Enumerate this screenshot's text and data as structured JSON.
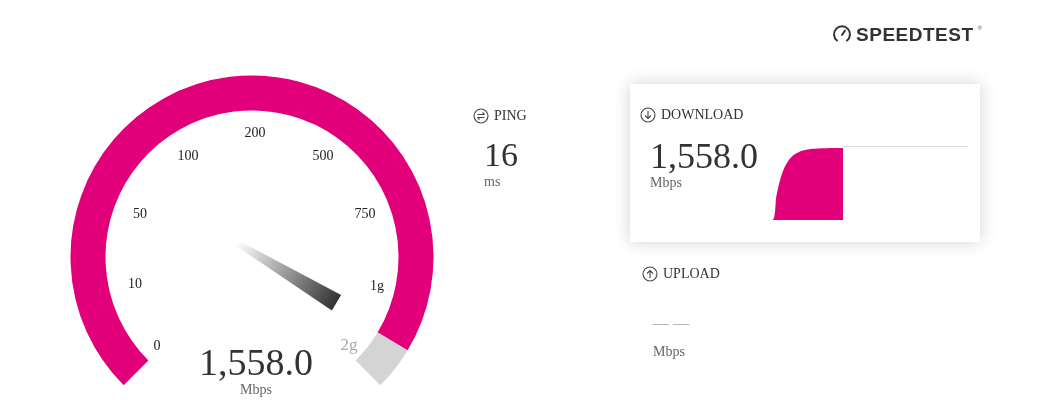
{
  "logo": {
    "text": "SPEEDTEST",
    "registered": "®"
  },
  "gauge": {
    "ticks": [
      {
        "label": "0",
        "dimmed": false
      },
      {
        "label": "10",
        "dimmed": false
      },
      {
        "label": "50",
        "dimmed": false
      },
      {
        "label": "100",
        "dimmed": false
      },
      {
        "label": "200",
        "dimmed": false
      },
      {
        "label": "500",
        "dimmed": false
      },
      {
        "label": "750",
        "dimmed": false
      },
      {
        "label": "1g",
        "dimmed": false
      },
      {
        "label": "2g",
        "dimmed": true
      }
    ],
    "value": "1,558.0",
    "unit": "Mbps"
  },
  "ping": {
    "label": "PING",
    "value": "16",
    "unit": "ms"
  },
  "download": {
    "label": "DOWNLOAD",
    "value": "1,558.0",
    "unit": "Mbps"
  },
  "upload": {
    "label": "UPLOAD",
    "value": "— —",
    "unit": "Mbps"
  }
}
